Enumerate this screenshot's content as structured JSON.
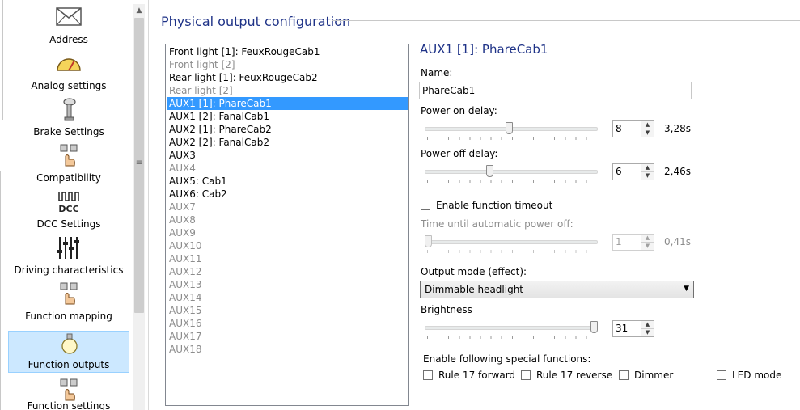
{
  "sidebar": {
    "items": [
      {
        "label": "Address",
        "icon": "envelope-icon"
      },
      {
        "label": "Analog settings",
        "icon": "gauge-icon"
      },
      {
        "label": "Brake Settings",
        "icon": "brake-lever-icon"
      },
      {
        "label": "Compatibility",
        "icon": "hand-buttons-icon"
      },
      {
        "label": "DCC Settings",
        "icon": "dcc-icon",
        "icon_text": "DCC"
      },
      {
        "label": "Driving characteristics",
        "icon": "sliders-icon"
      },
      {
        "label": "Function mapping",
        "icon": "hand-buttons-icon"
      },
      {
        "label": "Function outputs",
        "icon": "lightbulb-icon",
        "selected": true
      },
      {
        "label": "Function settings",
        "icon": "hand-buttons-icon"
      }
    ]
  },
  "page": {
    "title": "Physical output configuration"
  },
  "outputs": [
    {
      "label": "Front light [1]: FeuxRougeCab1",
      "state": "normal"
    },
    {
      "label": "Front light [2]",
      "state": "dim"
    },
    {
      "label": "Rear light [1]: FeuxRougeCab2",
      "state": "normal"
    },
    {
      "label": "Rear light [2]",
      "state": "dim"
    },
    {
      "label": "AUX1 [1]: PhareCab1",
      "state": "selected"
    },
    {
      "label": "AUX1 [2]: FanalCab1",
      "state": "normal"
    },
    {
      "label": "AUX2 [1]: PhareCab2",
      "state": "normal"
    },
    {
      "label": "AUX2 [2]: FanalCab2",
      "state": "normal"
    },
    {
      "label": "AUX3",
      "state": "normal"
    },
    {
      "label": "AUX4",
      "state": "dim"
    },
    {
      "label": "AUX5: Cab1",
      "state": "normal"
    },
    {
      "label": "AUX6: Cab2",
      "state": "normal"
    },
    {
      "label": "AUX7",
      "state": "dim"
    },
    {
      "label": "AUX8",
      "state": "dim"
    },
    {
      "label": "AUX9",
      "state": "dim"
    },
    {
      "label": "AUX10",
      "state": "dim"
    },
    {
      "label": "AUX11",
      "state": "dim"
    },
    {
      "label": "AUX12",
      "state": "dim"
    },
    {
      "label": "AUX13",
      "state": "dim"
    },
    {
      "label": "AUX14",
      "state": "dim"
    },
    {
      "label": "AUX15",
      "state": "dim"
    },
    {
      "label": "AUX16",
      "state": "dim"
    },
    {
      "label": "AUX17",
      "state": "dim"
    },
    {
      "label": "AUX18",
      "state": "dim"
    }
  ],
  "detail": {
    "title": "AUX1 [1]: PhareCab1",
    "name_label": "Name:",
    "name_value": "PhareCab1",
    "power_on": {
      "label": "Power on delay:",
      "value": "8",
      "display": "3,28s",
      "level": 0.49
    },
    "power_off": {
      "label": "Power off delay:",
      "value": "6",
      "display": "2,46s",
      "level": 0.37
    },
    "timeout": {
      "label": "Enable function timeout",
      "checked": false
    },
    "auto_off": {
      "label": "Time until automatic power off:",
      "value": "1",
      "display": "0,41s",
      "level": 0.0,
      "disabled": true
    },
    "output_mode": {
      "label": "Output mode (effect):",
      "value": "Dimmable headlight"
    },
    "brightness": {
      "label": "Brightness",
      "value": "31",
      "level": 1.0
    },
    "special": {
      "label": "Enable following special functions:",
      "options": [
        {
          "label": "Rule 17 forward",
          "checked": false
        },
        {
          "label": "Rule 17 reverse",
          "checked": false
        },
        {
          "label": "Dimmer",
          "checked": false
        },
        {
          "label": "LED mode",
          "checked": false
        }
      ]
    }
  }
}
